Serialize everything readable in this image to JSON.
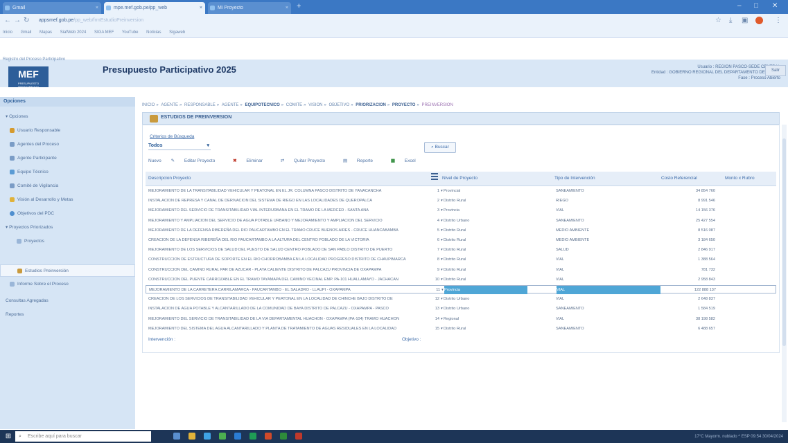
{
  "browser": {
    "tabs": [
      {
        "label": "Gmail"
      },
      {
        "label": "mpe.mef.gob.pe/pp_web"
      },
      {
        "label": "Mi Proyecto"
      }
    ],
    "new_tab": "+",
    "url": "appsmef.gob.pe",
    "url_rest": "/pp_web/frmEstudioPreinversion",
    "window_controls": [
      "–",
      "□",
      "✕"
    ]
  },
  "bookmarks": [
    "Inicio",
    "Gmail",
    "Mapas",
    "SiafWeb 2024",
    "SIGA MEF",
    "YouTube",
    "Noticias",
    "Sigaweb"
  ],
  "app": {
    "portal_label": "Registro del Proceso Participativo",
    "logo_text": "MEF",
    "logo_sub": "PRESUPUESTO PARTICIPATIVO",
    "title": "Presupuesto Participativo 2025",
    "user_line1": "Usuario : REGION PASCO-SEDE CENTRAL",
    "user_line2": "Entidad : GOBIERNO REGIONAL DEL DEPARTAMENTO DE PASCO",
    "user_line3": "Fase : Proceso Abierto",
    "salir": "Salir"
  },
  "sidebar": {
    "header": "Opciones",
    "items": [
      {
        "label": "Opciones"
      },
      {
        "label": "Usuario Responsable"
      },
      {
        "label": "Agentes del Proceso"
      },
      {
        "label": "Agente Participante"
      },
      {
        "label": "Equipo Técnico"
      },
      {
        "label": "Comité de Vigilancia"
      },
      {
        "label": "Visión al Desarrollo y Metas"
      },
      {
        "label": "Objetivos del PDC"
      },
      {
        "label": "Proyectos Priorizados"
      },
      {
        "label": "Proyectos"
      },
      {
        "label": "Estudios Preinversión"
      },
      {
        "label": "Informe Sobre el Proceso"
      },
      {
        "label": "Consultas Agregadas"
      },
      {
        "label": "Reportes"
      }
    ]
  },
  "breadcrumbs": [
    "INICIO",
    "AGENTE",
    "RESPONSABLE",
    "AGENTE",
    "EQUIPOTECNICO",
    "COMITE",
    "VISION",
    "OBJETIVO",
    "PRIORIZACION",
    "PROYECTO",
    "PREINVERSION"
  ],
  "panel": {
    "title": "ESTUDIOS DE PREINVERSION",
    "criteria_label": "Criterios de Búsqueda",
    "filter_value": "Todos",
    "buscar": "Buscar",
    "toolbar": [
      "Nuevo",
      "Editar Proyecto",
      "Eliminar",
      "Quitar Proyecto",
      "Reporte",
      "Excel"
    ],
    "columns": [
      "Descripcion Proyecto",
      "Nivel de Proyecto",
      "Tipo de Intervención",
      "Costo Referencial",
      "Monto x Rubro"
    ],
    "rows": [
      {
        "desc": "MEJORAMIENTO DE LA TRANSITABILIDAD VEHICULAR Y PEATONAL EN EL JR. COLUMNA PASCO DISTRITO DE YANACANCHA",
        "n": "1",
        "nivel": "Provincial",
        "tipo": "SANEAMIENTO",
        "costo": "34 854 760"
      },
      {
        "desc": "INSTALACION DE REPRESA Y CANAL DE DERIVACION DEL SISTEMA DE RIEGO EN LAS LOCALIDADES DE QUEROPALCA",
        "n": "2",
        "nivel": "Distrito Rural",
        "tipo": "RIEGO",
        "costo": "8 991 546"
      },
      {
        "desc": "MEJORAMIENTO DEL SERVICIO DE TRANSITABILIDAD VIAL INTERURBANA EN EL TRAMO DE LA MERCED - SANTA ANA",
        "n": "3",
        "nivel": "Provincia",
        "tipo": "VIAL",
        "costo": "14 156 376"
      },
      {
        "desc": "MEJORAMIENTO Y AMPLIACION DEL SERVICIO DE AGUA POTABLE URBANO Y MEJORAMIENTO Y AMPLIACION DEL SERVICIO",
        "n": "4",
        "nivel": "Distrito Urbano",
        "tipo": "SANEAMIENTO",
        "costo": "25 427 554"
      },
      {
        "desc": "MEJORAMIENTO DE LA DEFENSA RIBEREÑA DEL RIO PAUCARTAMBO EN EL TRAMO CRUCE BUENOS AIRES - CRUCE HUANCABAMBA",
        "n": "5",
        "nivel": "Distrito Rural",
        "tipo": "MEDIO AMBIENTE",
        "costo": "8 516 087"
      },
      {
        "desc": "CREACION DE LA DEFENSA RIBEREÑA DEL RIO PAUCARTAMBO A LA ALTURA DEL CENTRO POBLADO DE LA VICTORIA",
        "n": "6",
        "nivel": "Distrito Rural",
        "tipo": "MEDIO AMBIENTE",
        "costo": "3 184 650"
      },
      {
        "desc": "MEJORAMIENTO DE LOS SERVICIOS DE SALUD DEL PUESTO DE SALUD CENTRO POBLADO DE SAN PABLO DISTRITO DE PUERTO",
        "n": "7",
        "nivel": "Distrito Rural",
        "tipo": "SALUD",
        "costo": "2 846 917"
      },
      {
        "desc": "CONSTRUCCION DE ESTRUCTURA DE SOPORTE EN EL RIO CHORROBAMBA EN LA LOCALIDAD PROGRESO DISTRITO DE CHAUPIMARCA",
        "n": "8",
        "nivel": "Distrito Rural",
        "tipo": "VIAL",
        "costo": "1 388 564"
      },
      {
        "desc": "CONSTRUCCION DEL CAMINO RURAL PAR DE AZUCAR - PLAYA CALIENTE DISTRITO DE PALCAZU PROVINCIA DE OXAPAMPA",
        "n": "9",
        "nivel": "Distrito Rural",
        "tipo": "VIAL",
        "costo": "781 732"
      },
      {
        "desc": "CONSTRUCCION DEL PUENTE CARROZABLE EN EL TRAMO TAYAMAPA DEL CAMINO VECINAL EMP. PA-101 HUALLAMAYO - JACHACAN",
        "n": "10",
        "nivel": "Distrito Rural",
        "tipo": "VIAL",
        "costo": "2 958 843"
      },
      {
        "desc": "MEJORAMIENTO DE LA CARRETERA CARRILAMARCA - PAUCARTAMBO - EL SALADRO - LLAUPI - OXAPAMPA",
        "n": "11",
        "nivel": "Provincia",
        "tipo": "VIAL",
        "costo": "122 888 137",
        "hl": true
      },
      {
        "desc": "CREACION DE LOS SERVICIOS DE TRANSITABILIDAD VEHICULAR Y PEATONAL EN LA LOCALIDAD DE CHINCHE BAJO DISTRITO DE",
        "n": "12",
        "nivel": "Distrito Urbano",
        "tipo": "VIAL",
        "costo": "2 648 837"
      },
      {
        "desc": "INSTALACION DE AGUA POTABLE Y ALCANTARILLADO DE LA COMUNIDAD DE BAYA DISTRITO DE PALCAZU - OXAPAMPA - PASCO",
        "n": "13",
        "nivel": "Distrito Urbano",
        "tipo": "SANEAMIENTO",
        "costo": "1 584 519"
      },
      {
        "desc": "MEJORAMIENTO DEL SERVICIO DE TRANSITABILIDAD DE LA VIA DEPARTAMENTAL HUACHON - OXAPAMPA (PA-104) TRAMO HUACHON",
        "n": "14",
        "nivel": "Regional",
        "tipo": "VIAL",
        "costo": "38 198 582"
      },
      {
        "desc": "MEJORAMIENTO DEL SISTEMA DEL AGUA ALCANTARILLADO Y PLANTA DE TRATAMIENTO DE AGUAS RESIDUALES EN LA LOCALIDAD",
        "n": "15",
        "nivel": "Distrito Rural",
        "tipo": "SANEAMIENTO",
        "costo": "6 488 657"
      }
    ],
    "intervencion_label": "Intervención :",
    "objetivo_label": "Objetivo :"
  },
  "taskbar": {
    "search_placeholder": "Escribe aquí para buscar",
    "tray": "17°C Mayorm. nublado  ^  ESP  09:54  30/04/2024"
  }
}
